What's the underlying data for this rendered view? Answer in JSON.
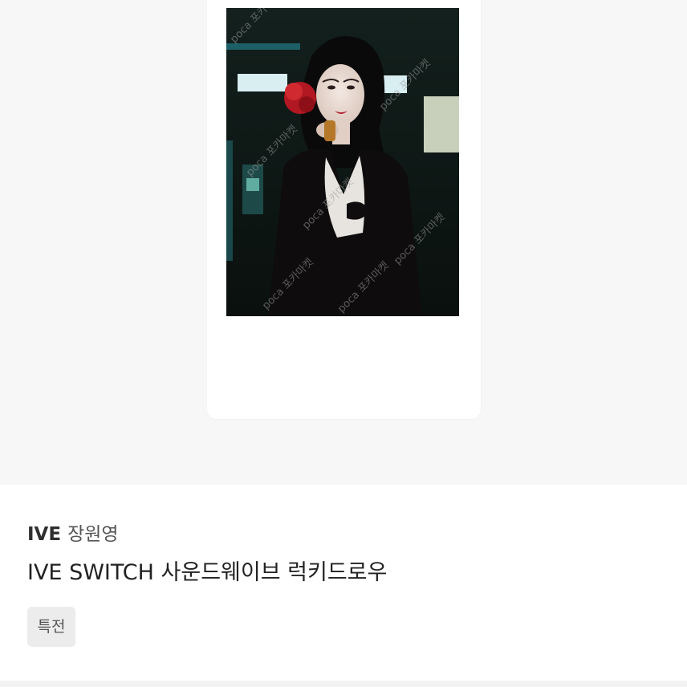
{
  "product": {
    "image": {
      "watermark_text": "poca 포카마켓"
    },
    "artist": {
      "group": "IVE",
      "member": "장원영"
    },
    "title": "IVE SWITCH 사운드웨이브 럭키드로우",
    "tag": "특전"
  },
  "colors": {
    "hero_background": "#f7f7f7",
    "tag_background": "#ececec",
    "text_primary": "#222222"
  }
}
